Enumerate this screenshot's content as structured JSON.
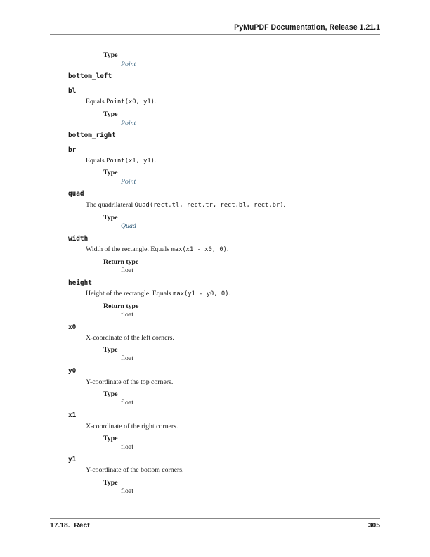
{
  "header": {
    "title": "PyMuPDF Documentation, Release 1.21.1"
  },
  "footer": {
    "section": "17.18.  Rect",
    "page_number": "305"
  },
  "content": {
    "b0": {
      "field_label": "Type",
      "field_value": "Point"
    },
    "b1": {
      "signature": "bottom_left"
    },
    "b2": {
      "signature": "bl",
      "desc_pre": "Equals ",
      "desc_code": "Point(x0, y1)",
      "desc_post": ".",
      "field_label": "Type",
      "field_value": "Point"
    },
    "b3": {
      "signature": "bottom_right"
    },
    "b4": {
      "signature": "br",
      "desc_pre": "Equals ",
      "desc_code": "Point(x1, y1)",
      "desc_post": ".",
      "field_label": "Type",
      "field_value": "Point"
    },
    "b5": {
      "signature": "quad",
      "desc_pre": "The quadrilateral ",
      "desc_code": "Quad(rect.tl, rect.tr, rect.bl, rect.br)",
      "desc_post": ".",
      "field_label": "Type",
      "field_value": "Quad"
    },
    "b6": {
      "signature": "width",
      "desc_pre": "Width of the rectangle. Equals ",
      "desc_code": "max(x1 - x0, 0)",
      "desc_post": ".",
      "field_label": "Return type",
      "field_value": "float"
    },
    "b7": {
      "signature": "height",
      "desc_pre": "Height of the rectangle. Equals ",
      "desc_code": "max(y1 - y0, 0)",
      "desc_post": ".",
      "field_label": "Return type",
      "field_value": "float"
    },
    "b8": {
      "signature": "x0",
      "desc": "X-coordinate of the left corners.",
      "field_label": "Type",
      "field_value": "float"
    },
    "b9": {
      "signature": "y0",
      "desc": "Y-coordinate of the top corners.",
      "field_label": "Type",
      "field_value": "float"
    },
    "b10": {
      "signature": "x1",
      "desc": "X-coordinate of the right corners.",
      "field_label": "Type",
      "field_value": "float"
    },
    "b11": {
      "signature": "y1",
      "desc": "Y-coordinate of the bottom corners.",
      "field_label": "Type",
      "field_value": "float"
    }
  }
}
